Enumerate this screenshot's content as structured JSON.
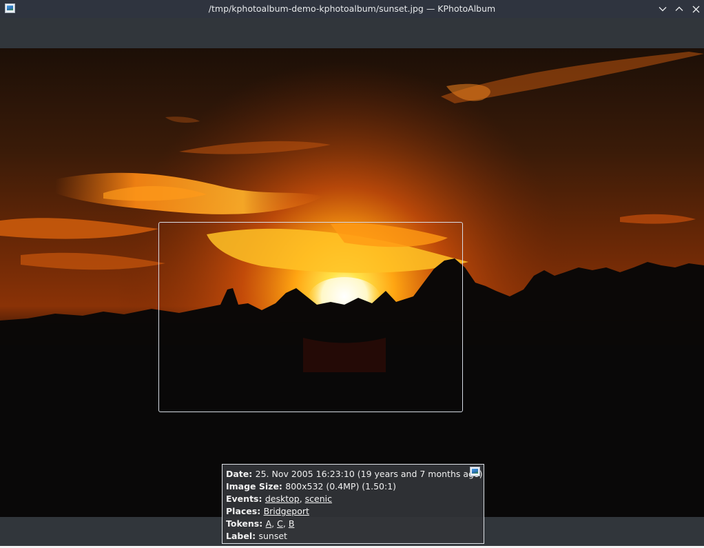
{
  "window": {
    "title": "/tmp/kphotoalbum-demo-kphotoalbum/sunset.jpg — KPhotoAlbum",
    "icon": "kphotoalbum-app-icon"
  },
  "controls": {
    "minimize_icon": "chevron-down-icon",
    "maximize_icon": "chevron-up-icon",
    "close_icon": "close-icon"
  },
  "photo": {
    "subject": "sunset",
    "has_selection_rectangle": true
  },
  "info": {
    "date_label": "Date:",
    "date_value": "25. Nov 2005 16:23:10 (19 years and 7 months ago)",
    "size_label": "Image Size:",
    "size_value": "800x532 (0.4MP) (1.50:1)",
    "events_label": "Events:",
    "events": [
      "desktop",
      "scenic"
    ],
    "places_label": "Places:",
    "places": [
      "Bridgeport"
    ],
    "tokens_label": "Tokens:",
    "tokens": [
      "A",
      "C",
      "B"
    ],
    "label_label": "Label:",
    "label_value": "sunset",
    "separator": ", "
  },
  "colors": {
    "titlebar_bg": "#2f343f",
    "panel_bg": "#31363b",
    "sun_core": "#fff6c8",
    "glow": "#ff9a10"
  }
}
